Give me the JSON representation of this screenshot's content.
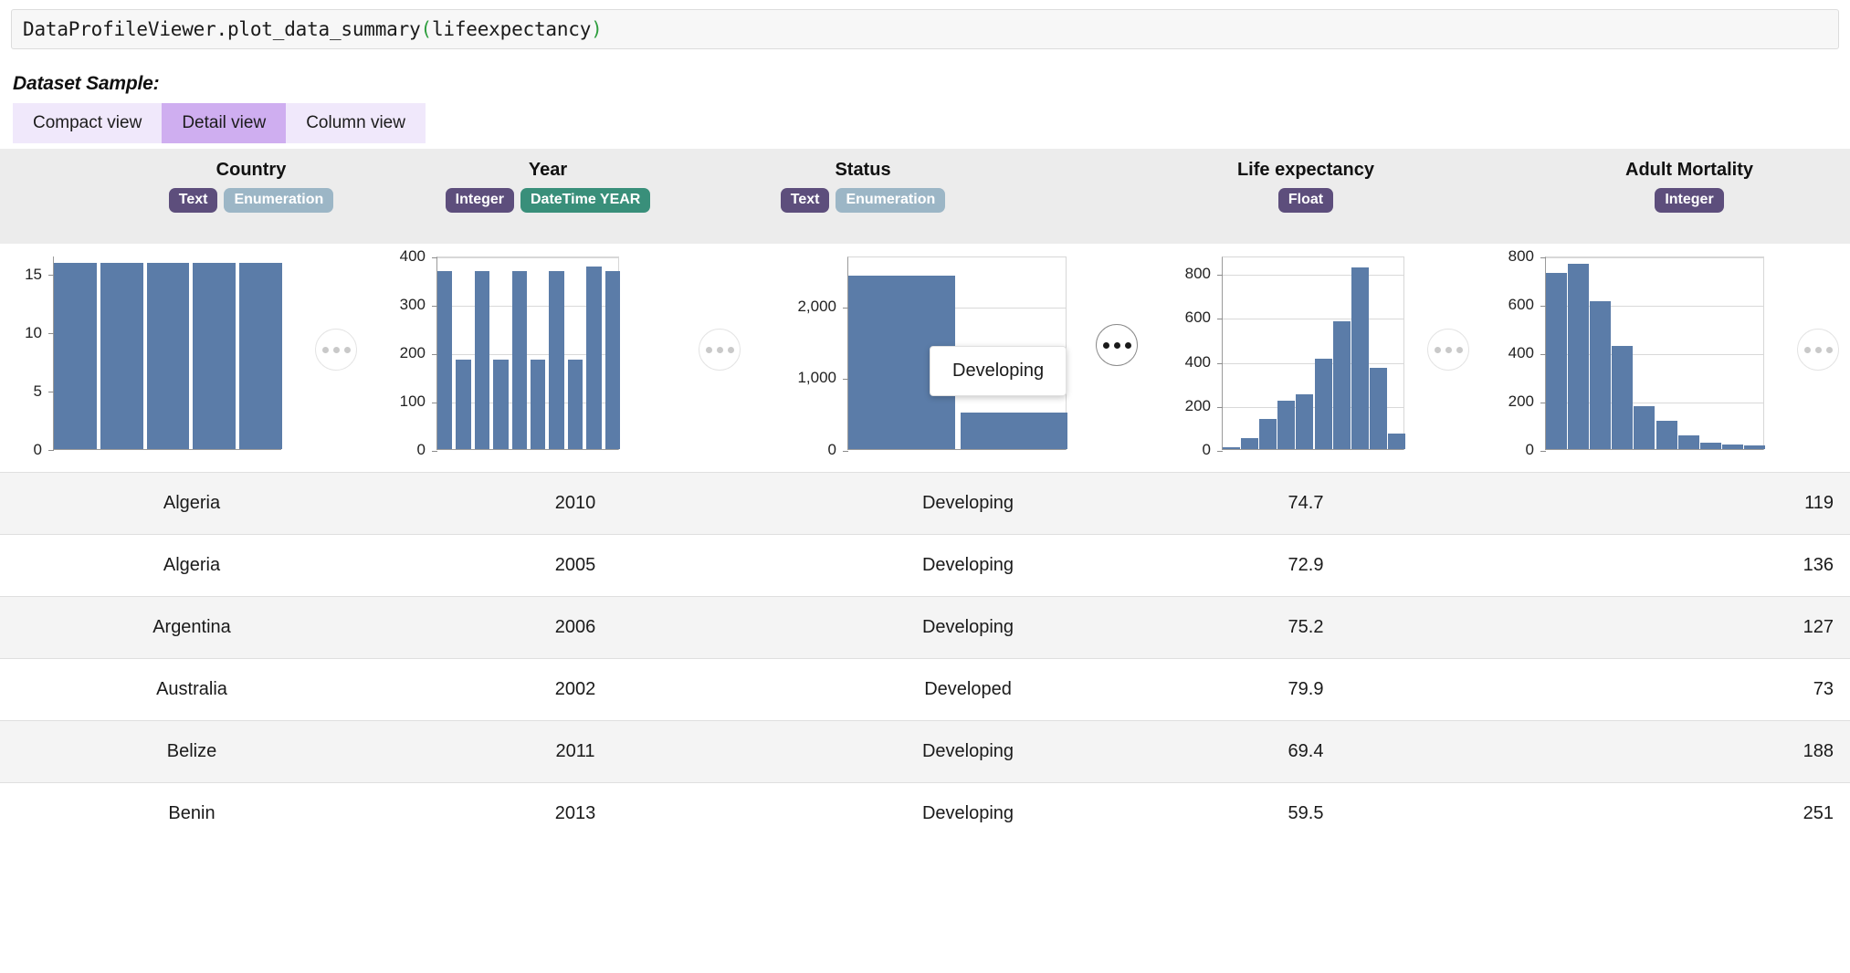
{
  "code_bar": {
    "prefix": "DataProfileViewer.plot_data_summary",
    "open_paren": "(",
    "arg": "lifeexpectancy",
    "close_paren": ")"
  },
  "section": {
    "title": "Dataset Sample:"
  },
  "tabs": [
    {
      "label": "Compact view",
      "active": false
    },
    {
      "label": "Detail view",
      "active": true
    },
    {
      "label": "Column view",
      "active": false
    }
  ],
  "columns": [
    {
      "title": "Country",
      "badges": [
        {
          "label": "Text",
          "kind": "text"
        },
        {
          "label": "Enumeration",
          "kind": "enumeration"
        }
      ]
    },
    {
      "title": "Year",
      "badges": [
        {
          "label": "Integer",
          "kind": "integer"
        },
        {
          "label": "DateTime YEAR",
          "kind": "datetime"
        }
      ]
    },
    {
      "title": "Status",
      "badges": [
        {
          "label": "Text",
          "kind": "text"
        },
        {
          "label": "Enumeration",
          "kind": "enumeration"
        }
      ]
    },
    {
      "title": "Life expectancy",
      "badges": [
        {
          "label": "Float",
          "kind": "float"
        }
      ]
    },
    {
      "title": "Adult Mortality",
      "badges": [
        {
          "label": "Integer",
          "kind": "integer"
        }
      ]
    }
  ],
  "tooltip": {
    "label": "Developing"
  },
  "overflow_menu": {
    "label": "more-options"
  },
  "colors": {
    "bar": "#5b7ca8",
    "tab_active": "#cfaef0",
    "tab_inactive": "#f0e8fb",
    "header_band": "#ececec",
    "badge_purple": "#5d4e7c",
    "badge_blue": "#9cb6c6",
    "badge_teal": "#398f7a"
  },
  "chart_data": [
    {
      "type": "bar",
      "title": "Country",
      "xlabel": "",
      "ylabel": "",
      "categories": [
        "b1",
        "b2",
        "b3",
        "b4",
        "b5"
      ],
      "values": [
        16,
        16,
        16,
        16,
        16
      ],
      "yticks": [
        0,
        5,
        10,
        15
      ],
      "ylim": [
        0,
        16.6
      ],
      "grid": false
    },
    {
      "type": "bar",
      "title": "Year",
      "xlabel": "",
      "ylabel": "",
      "categories": [
        "b1",
        "b2",
        "b3",
        "b4",
        "b5",
        "b6",
        "b7",
        "b8",
        "b9",
        "b10"
      ],
      "values": [
        368,
        184,
        368,
        184,
        368,
        184,
        368,
        184,
        378,
        368
      ],
      "yticks": [
        0,
        100,
        200,
        300,
        400
      ],
      "ylim": [
        0,
        400
      ],
      "grid": true
    },
    {
      "type": "bar",
      "title": "Status",
      "xlabel": "",
      "ylabel": "",
      "categories": [
        "Developing",
        "Developed"
      ],
      "values": [
        2425,
        512
      ],
      "yticks": [
        0,
        1000,
        2000
      ],
      "ytick_labels": [
        "0",
        "1,000",
        "2,000"
      ],
      "ylim": [
        0,
        2700
      ],
      "grid": true
    },
    {
      "type": "bar",
      "title": "Life expectancy",
      "xlabel": "",
      "ylabel": "",
      "categories": [
        "b1",
        "b2",
        "b3",
        "b4",
        "b5",
        "b6",
        "b7",
        "b8",
        "b9",
        "b10"
      ],
      "values": [
        8,
        48,
        135,
        218,
        250,
        410,
        580,
        825,
        370,
        70
      ],
      "yticks": [
        0,
        200,
        400,
        600,
        800
      ],
      "ylim": [
        0,
        880
      ],
      "grid": true
    },
    {
      "type": "bar",
      "title": "Adult Mortality",
      "xlabel": "",
      "ylabel": "",
      "categories": [
        "b1",
        "b2",
        "b3",
        "b4",
        "b5",
        "b6",
        "b7",
        "b8",
        "b9",
        "b10"
      ],
      "values": [
        730,
        765,
        612,
        425,
        178,
        118,
        55,
        25,
        18,
        14
      ],
      "yticks": [
        0,
        200,
        400,
        600,
        800
      ],
      "ylim": [
        0,
        800
      ],
      "grid": true
    }
  ],
  "table": {
    "columns": [
      "Country",
      "Year",
      "Status",
      "Life expectancy",
      "Adult Mortality"
    ],
    "rows": [
      {
        "country": "Algeria",
        "year": "2010",
        "status": "Developing",
        "life_expectancy": "74.7",
        "adult_mortality": "119"
      },
      {
        "country": "Algeria",
        "year": "2005",
        "status": "Developing",
        "life_expectancy": "72.9",
        "adult_mortality": "136"
      },
      {
        "country": "Argentina",
        "year": "2006",
        "status": "Developing",
        "life_expectancy": "75.2",
        "adult_mortality": "127"
      },
      {
        "country": "Australia",
        "year": "2002",
        "status": "Developed",
        "life_expectancy": "79.9",
        "adult_mortality": "73"
      },
      {
        "country": "Belize",
        "year": "2011",
        "status": "Developing",
        "life_expectancy": "69.4",
        "adult_mortality": "188"
      },
      {
        "country": "Benin",
        "year": "2013",
        "status": "Developing",
        "life_expectancy": "59.5",
        "adult_mortality": "251"
      }
    ]
  }
}
